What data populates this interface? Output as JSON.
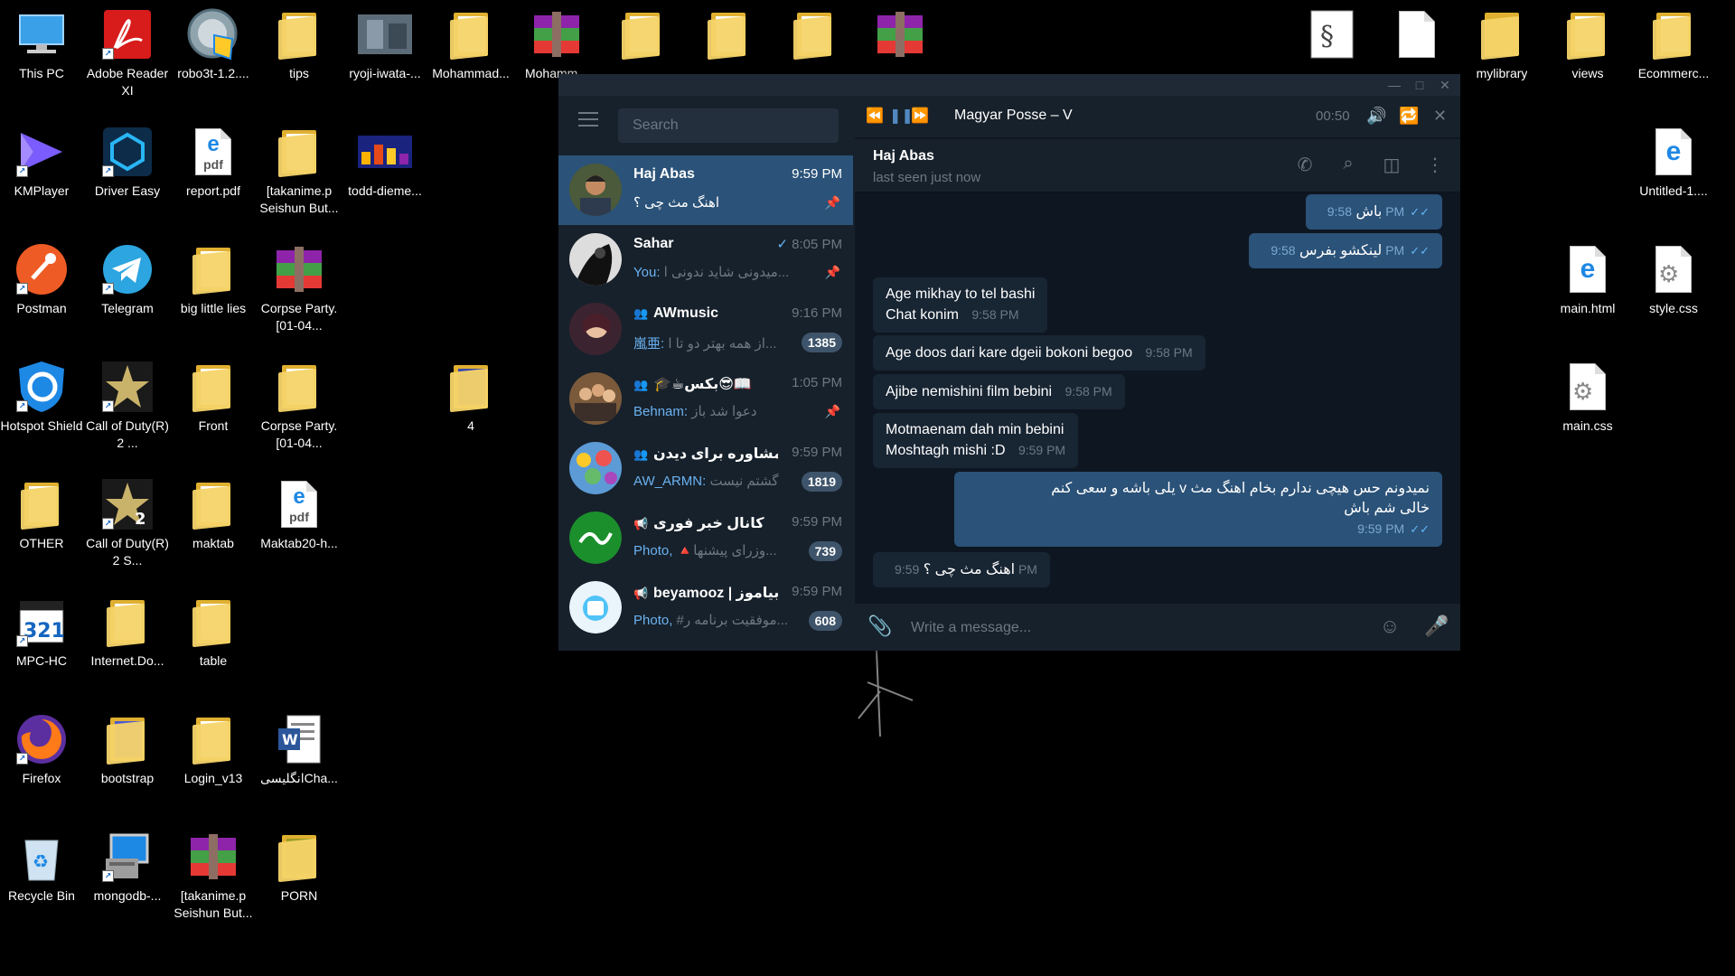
{
  "desktop": {
    "icons": [
      {
        "label": "This PC"
      },
      {
        "label": "Adobe Reader XI"
      },
      {
        "label": "robo3t-1.2...."
      },
      {
        "label": "tips"
      },
      {
        "label": "ryoji-iwata-..."
      },
      {
        "label": "Mohammad..."
      },
      {
        "label": "Mohamm..."
      },
      {
        "label": "KMPlayer"
      },
      {
        "label": "Driver Easy"
      },
      {
        "label": "report.pdf"
      },
      {
        "label": "[takanime.p Seishun But..."
      },
      {
        "label": "todd-dieme..."
      },
      {
        "label": "Postman"
      },
      {
        "label": "Telegram"
      },
      {
        "label": "big little lies"
      },
      {
        "label": "Corpse Party.[01-04..."
      },
      {
        "label": "Hotspot Shield"
      },
      {
        "label": "Call of Duty(R) 2 ..."
      },
      {
        "label": "Front"
      },
      {
        "label": "Corpse Party.[01-04..."
      },
      {
        "label": "4"
      },
      {
        "label": "OTHER"
      },
      {
        "label": "Call of Duty(R) 2 S..."
      },
      {
        "label": "maktab"
      },
      {
        "label": "Maktab20-h..."
      },
      {
        "label": "MPC-HC"
      },
      {
        "label": "Internet.Do..."
      },
      {
        "label": "table"
      },
      {
        "label": "Firefox"
      },
      {
        "label": "bootstrap"
      },
      {
        "label": "Login_v13"
      },
      {
        "label": "انگلیسیCha..."
      },
      {
        "label": "Recycle Bin"
      },
      {
        "label": "mongodb-..."
      },
      {
        "label": "[takanime.p Seishun But..."
      },
      {
        "label": "PORN"
      },
      {
        "label": "mylibrary"
      },
      {
        "label": "views"
      },
      {
        "label": "Ecommerc..."
      },
      {
        "label": "Untitled-1...."
      },
      {
        "label": "main.html"
      },
      {
        "label": "style.css"
      },
      {
        "label": "main.css"
      }
    ]
  },
  "telegram": {
    "window_controls": {
      "minimize": "—",
      "maximize": "□",
      "close": "✕"
    },
    "search_placeholder": "Search",
    "player": {
      "track": "Magyar Posse – V",
      "time": "00:50"
    },
    "chats": [
      {
        "name": "Haj Abas",
        "time": "9:59 PM",
        "sender": "",
        "preview": "اهنگ مث چی ؟",
        "pinned": true,
        "badge": ""
      },
      {
        "name": "Sahar",
        "time": "8:05 PM",
        "sender": "You:",
        "preview": "میدونی شاید ندونی ا...",
        "pinned": true,
        "badge": "",
        "sent": "✓"
      },
      {
        "name": "AWmusic",
        "time": "9:16 PM",
        "sender": "嵐亜:",
        "preview": "از همه بهتر دو تا ا...",
        "pinned": false,
        "badge": "1385",
        "group": true
      },
      {
        "name": "🎓☕بکس😎📖",
        "time": "1:05 PM",
        "sender": "Behnam:",
        "preview": "دعوا شد باز",
        "pinned": true,
        "badge": "",
        "group": true
      },
      {
        "name": "مشاوره برای دیدن...",
        "time": "9:59 PM",
        "sender": "AW_ARMN:",
        "preview": "گشتم نیست",
        "pinned": false,
        "badge": "1819",
        "group": true
      },
      {
        "name": "کانال خبر فوری",
        "time": "9:59 PM",
        "sender": "Photo,",
        "preview": "🔺وزرای پیشنها...",
        "pinned": false,
        "badge": "739",
        "channel": true
      },
      {
        "name": "beyamooz | بیاموز",
        "time": "9:59 PM",
        "sender": "Photo,",
        "preview": "#موفقیت برنامه ر...",
        "pinned": false,
        "badge": "608",
        "channel": true
      }
    ],
    "header": {
      "title": "Haj Abas",
      "status": "last seen just now"
    },
    "messages": [
      {
        "dir": "out",
        "text": "باش",
        "time": "9:58 PM"
      },
      {
        "dir": "out",
        "text": "لینکشو بفرس",
        "time": "9:58 PM"
      },
      {
        "dir": "in",
        "text": "Age mikhay to tel bashi\nChat konim",
        "time": "9:58 PM"
      },
      {
        "dir": "in",
        "text": "Age doos dari kare dgeii bokoni begoo",
        "time": "9:58 PM"
      },
      {
        "dir": "in",
        "text": "Ajibe nemishini film bebini",
        "time": "9:58 PM"
      },
      {
        "dir": "in",
        "text": "Motmaenam dah min bebini\nMoshtagh mishi :D",
        "time": "9:59 PM"
      },
      {
        "dir": "out",
        "text": "نمیدونم حس هیچی ندارم بخام اهنگ مث v  یلی باشه و سعی کنم\nخالی شم باش",
        "time": "9:59 PM"
      },
      {
        "dir": "in",
        "text": "اهنگ مث چی ؟",
        "time": "9:59 PM"
      }
    ],
    "composer_placeholder": "Write a message..."
  }
}
